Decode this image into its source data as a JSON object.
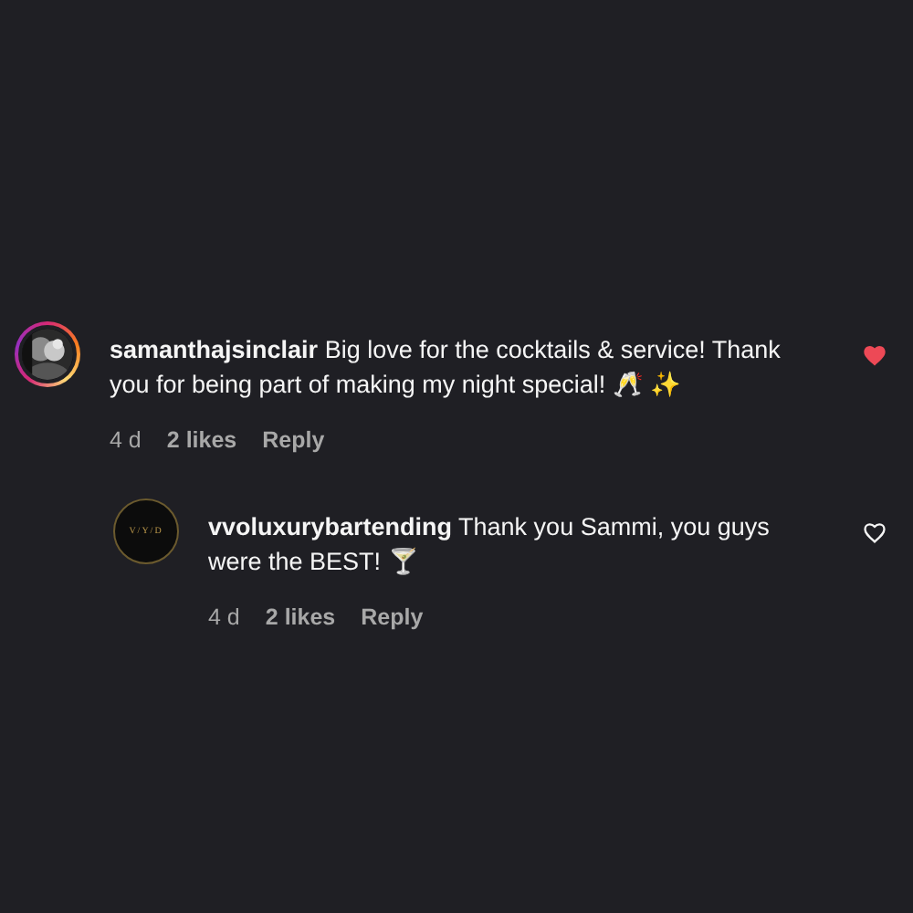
{
  "comments": [
    {
      "username": "samanthajsinclair",
      "text": "Big love for the cocktails & service! Thank you for being part of making my night special!  🥂 ✨",
      "time": "4 d",
      "likes": "2 likes",
      "reply": "Reply",
      "liked": true,
      "avatar": {
        "kind": "picture",
        "story_ring": true
      },
      "reply_level": false
    },
    {
      "username": "vvoluxurybartending",
      "text": "Thank you Sammi, you guys were the BEST!  🍸",
      "time": "4 d",
      "likes": "2 likes",
      "reply": "Reply",
      "liked": false,
      "avatar": {
        "kind": "logo",
        "logo_text": "V/Y/D",
        "story_ring": false
      },
      "reply_level": true
    }
  ]
}
